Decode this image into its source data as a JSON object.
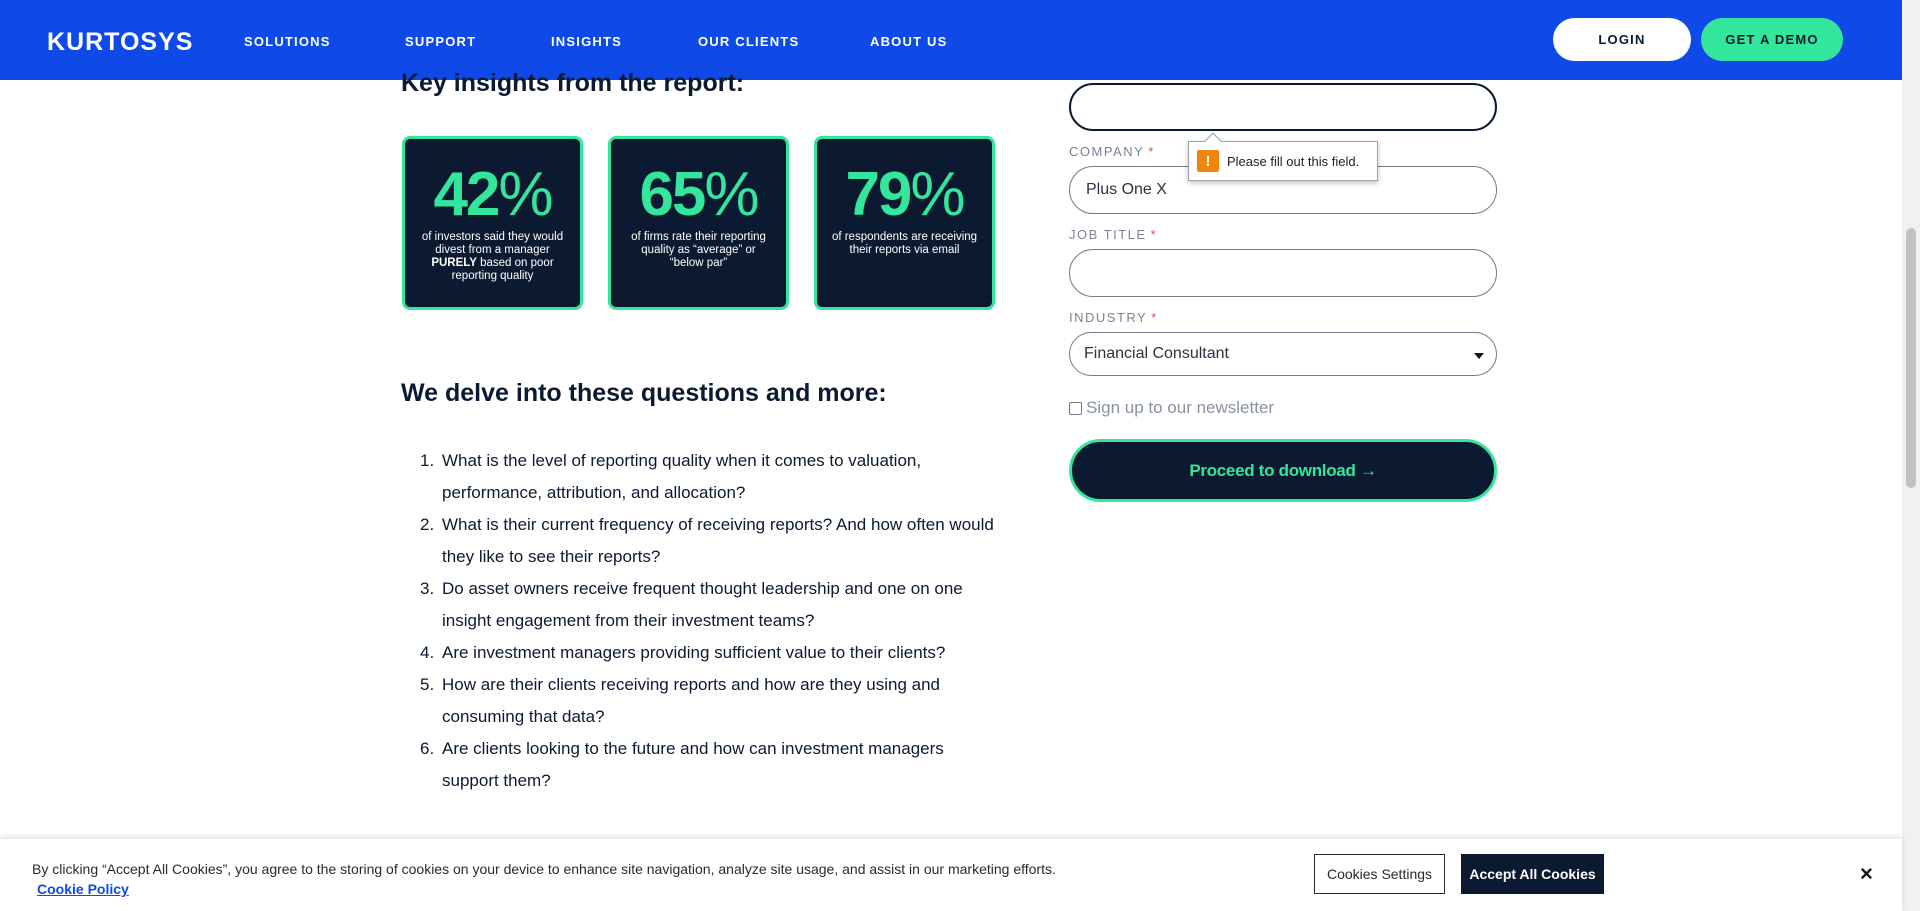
{
  "header": {
    "logo": "KURTOSYS",
    "nav": [
      "SOLUTIONS",
      "SUPPORT",
      "INSIGHTS",
      "OUR CLIENTS",
      "ABOUT US"
    ],
    "login_label": "LOGIN",
    "demo_label": "GET A DEMO",
    "colors": {
      "nav_bg": "#0f4ae8",
      "accent": "#33e69b",
      "dark": "#0c1a31"
    }
  },
  "insights": {
    "title": "Key insights from the report:",
    "cards": [
      {
        "number": "42",
        "percent": "%",
        "caption_pre": "of investors said they would divest from a manager ",
        "caption_bold": "PURELY",
        "caption_post": " based on poor reporting quality"
      },
      {
        "number": "65",
        "percent": "%",
        "caption_pre": "of firms rate their reporting quality as “average” or “below par”",
        "caption_bold": "",
        "caption_post": ""
      },
      {
        "number": "79",
        "percent": "%",
        "caption_pre": "of respondents are receiving their reports via email",
        "caption_bold": "",
        "caption_post": ""
      }
    ]
  },
  "questions": {
    "title": "We delve into these questions and more:",
    "items": [
      {
        "num": "1.",
        "text": "What is the level of reporting quality when it comes to valuation, performance, attribution, and allocation?"
      },
      {
        "num": "2.",
        "text": "What is their current frequency of receiving reports? And how often would they like to see their reports?"
      },
      {
        "num": "3.",
        "text": "Do asset owners receive frequent thought leadership and one on one insight engagement from their investment teams?"
      },
      {
        "num": "4.",
        "text": "Are investment managers providing sufficient value to their clients?"
      },
      {
        "num": "5.",
        "text": "How are their clients receiving reports and how are they using and consuming that data?"
      },
      {
        "num": "6.",
        "text": "Are clients looking to the future and how can investment managers support them?"
      }
    ]
  },
  "form": {
    "first_field_value": "",
    "company_label": "COMPANY",
    "company_value": "Plus One X",
    "job_title_label": "JOB TITLE",
    "job_title_value": "",
    "industry_label": "INDUSTRY",
    "industry_value": "Financial Consultant",
    "required_mark": "*",
    "tooltip_text": "Please fill out this field.",
    "tooltip_icon": "!",
    "newsletter_label": "Sign up to our newsletter",
    "newsletter_checked": false,
    "submit_label": "Proceed to download →"
  },
  "cookies": {
    "text": "By clicking “Accept All Cookies”, you agree to the storing of cookies on your device to enhance site navigation, analyze site usage, and assist in our marketing efforts.",
    "policy_link": "Cookie Policy",
    "settings_label": "Cookies Settings",
    "accept_label": "Accept All Cookies",
    "close_icon": "×"
  }
}
